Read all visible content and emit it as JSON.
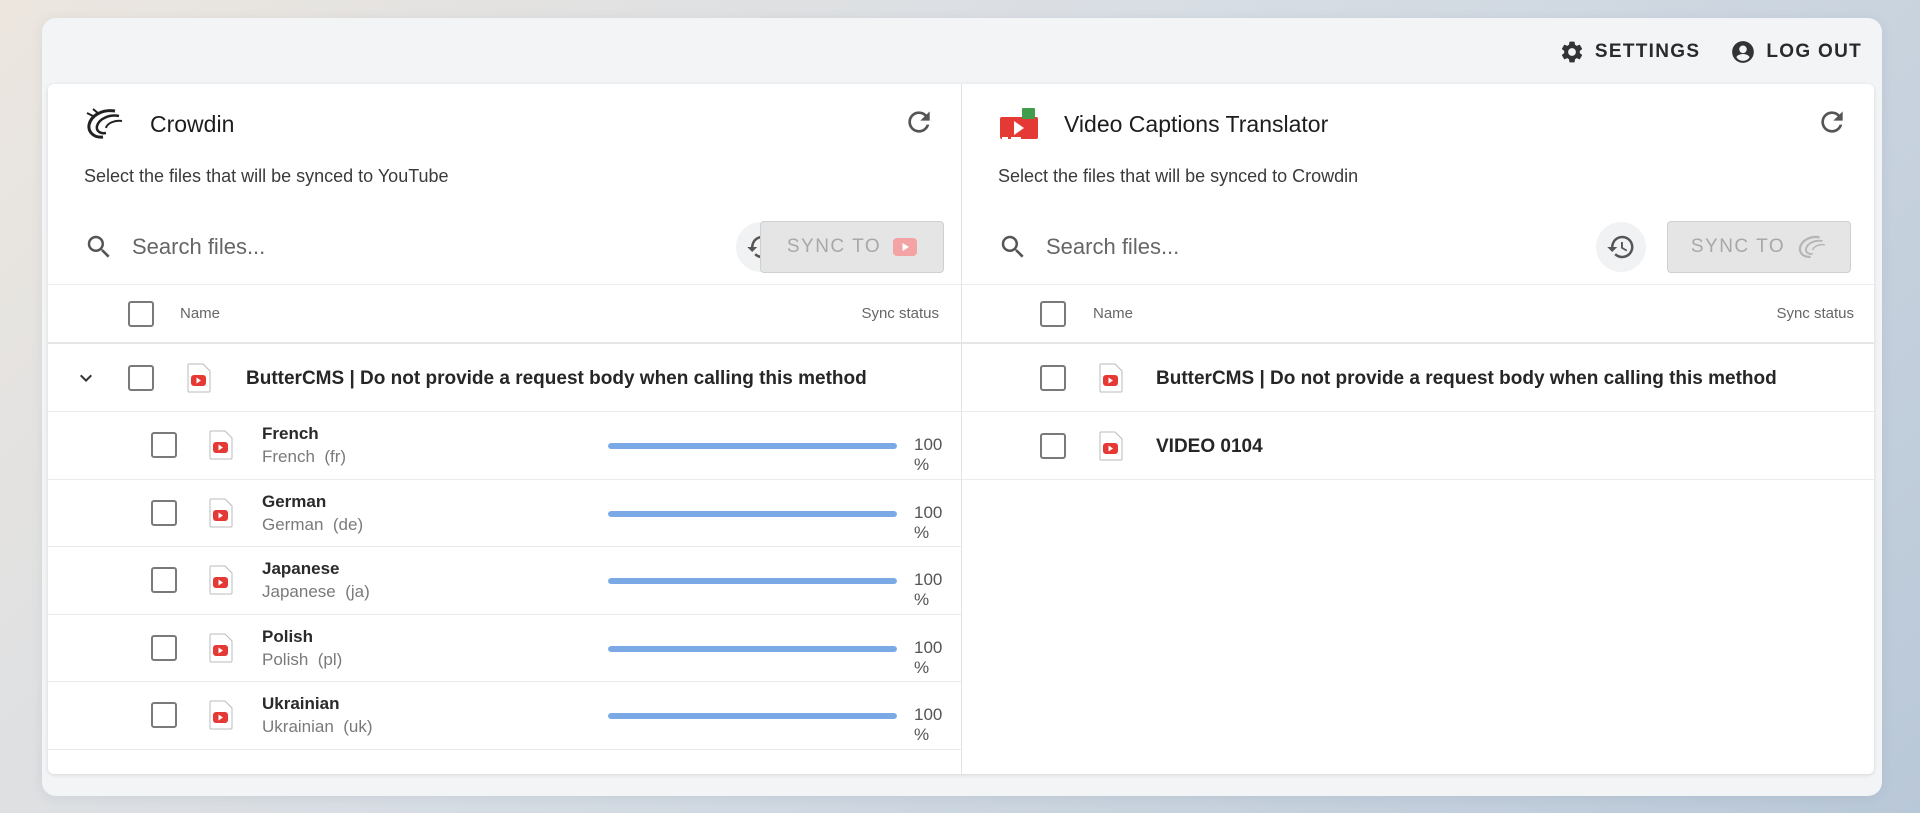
{
  "topbar": {
    "settings_label": "SETTINGS",
    "logout_label": "LOG OUT"
  },
  "left": {
    "title": "Crowdin",
    "description": "Select the files that will be synced to YouTube",
    "search_placeholder": "Search files...",
    "sync_label": "SYNC TO",
    "columns": {
      "name": "Name",
      "status": "Sync status"
    },
    "group": {
      "title": "ButterCMS | Do not provide a request body when calling this method"
    },
    "languages": [
      {
        "name": "French",
        "sub": "French",
        "code": "(fr)",
        "progress": 100,
        "pct_label": "100 %"
      },
      {
        "name": "German",
        "sub": "German",
        "code": "(de)",
        "progress": 100,
        "pct_label": "100 %"
      },
      {
        "name": "Japanese",
        "sub": "Japanese",
        "code": "(ja)",
        "progress": 100,
        "pct_label": "100 %"
      },
      {
        "name": "Polish",
        "sub": "Polish",
        "code": "(pl)",
        "progress": 100,
        "pct_label": "100 %"
      },
      {
        "name": "Ukrainian",
        "sub": "Ukrainian",
        "code": "(uk)",
        "progress": 100,
        "pct_label": "100 %"
      }
    ]
  },
  "right": {
    "title": "Video Captions Translator",
    "description": "Select the files that will be synced to Crowdin",
    "search_placeholder": "Search files...",
    "sync_label": "SYNC TO",
    "columns": {
      "name": "Name",
      "status": "Sync status"
    },
    "files": [
      {
        "title": "ButterCMS | Do not provide a request body when calling this method"
      },
      {
        "title": "VIDEO 0104"
      }
    ]
  },
  "colors": {
    "youtube_red": "#e53935",
    "progress_blue": "#7aa9e6",
    "disabled_gray": "#a8a8a8"
  }
}
